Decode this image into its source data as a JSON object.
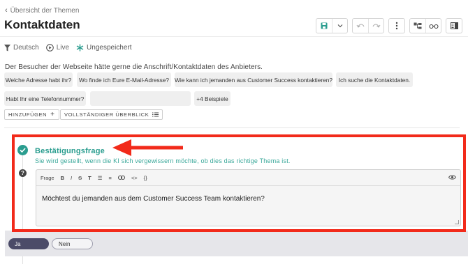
{
  "header": {
    "back_label": "Übersicht der Themen",
    "title": "Kontaktdaten"
  },
  "toolbar": {
    "icons": [
      "save-icon",
      "chevron-down-icon",
      "undo-icon",
      "redo-icon",
      "more-vertical-icon",
      "structure-icon",
      "glasses-icon",
      "panel-icon"
    ]
  },
  "status": {
    "language": "Deutsch",
    "live": "Live",
    "saved_state": "Ungespeichert"
  },
  "description": "Der Besucher der Webseite hätte gerne die Anschrift/Kontaktdaten des Anbieters.",
  "examples": {
    "chips": [
      "Welche Adresse habt ihr?",
      "Wo finde ich Eure E-Mail-Adresse?",
      "Wie kann ich jemanden aus Customer Success kontaktieren?",
      "Ich suche die Kontaktdaten.",
      "Habt Ihr eine Telefonnummer?",
      "",
      "+4 Beispiele"
    ],
    "add_label": "HINZUFÜGEN",
    "overview_label": "VOLLSTÄNDIGER ÜBERBLICK"
  },
  "confirmation": {
    "title": "Bestätigungsfrage",
    "subtitle": "Sie wird gestellt, wenn die KI sich vergewissern möchte, ob dies das richtige Thema ist.",
    "editor_label": "Frage",
    "editor_tools": [
      "B",
      "I",
      "S",
      "T",
      "☰",
      "≡",
      "🔗",
      "<>",
      "{}"
    ],
    "text": "Möchtest du jemanden aus dem Customer Success Team kontaktieren?"
  },
  "answers": {
    "yes": "Ja",
    "no": "Nein"
  },
  "colors": {
    "accent": "#2a9d8f",
    "annotation": "#f22a1a",
    "yes_button": "#4b4b68"
  }
}
